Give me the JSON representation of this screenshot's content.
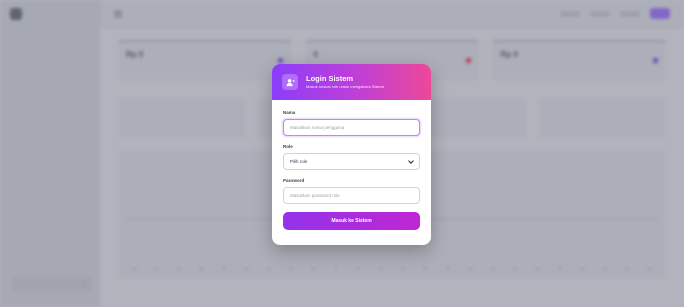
{
  "app": {
    "colors": {
      "accent": "#8b5cf6",
      "header_gradient_start": "#8b3dfb",
      "header_gradient_end": "#ec4899"
    }
  },
  "login": {
    "title": "Login Sistem",
    "subtitle": "Masuk sesuai role untuk mengakses Sistem",
    "name_label": "Nama",
    "name_placeholder": "Masukkan nama pengguna",
    "role_label": "Role",
    "role_selected": "Pilih role",
    "password_label": "Password",
    "password_placeholder": "Masukkan password role",
    "submit_label": "Masuk ke Sistem",
    "header_icon": "user-login-icon"
  },
  "background": {
    "cards": [
      {
        "value": "Rp 0",
        "dot_color": "#7c3aed"
      },
      {
        "value": "0",
        "dot_color": "#e11d48"
      },
      {
        "value": "Rp 0",
        "dot_color": "#4f46e5"
      }
    ]
  }
}
